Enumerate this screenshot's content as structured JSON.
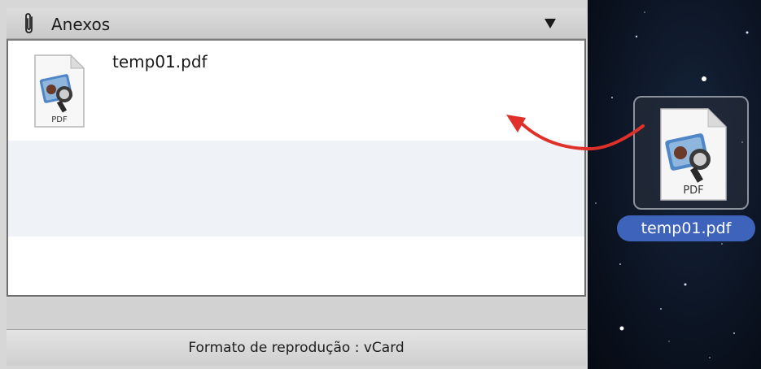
{
  "attachments_panel": {
    "title": "Anexos",
    "icon": "paperclip-icon",
    "dropdown_icon": "triangle-down-icon",
    "items": [
      {
        "filename": "temp01.pdf",
        "file_type_label": "PDF",
        "icon": "pdf-file-icon"
      }
    ],
    "status_text": "Formato de reprodução : vCard"
  },
  "desktop": {
    "file": {
      "filename": "temp01.pdf",
      "file_type_label": "PDF",
      "icon": "pdf-file-icon"
    },
    "drag_arrow": {
      "color": "#e0302a",
      "icon": "curved-arrow-icon"
    },
    "selection_color": "#3d63ba"
  }
}
